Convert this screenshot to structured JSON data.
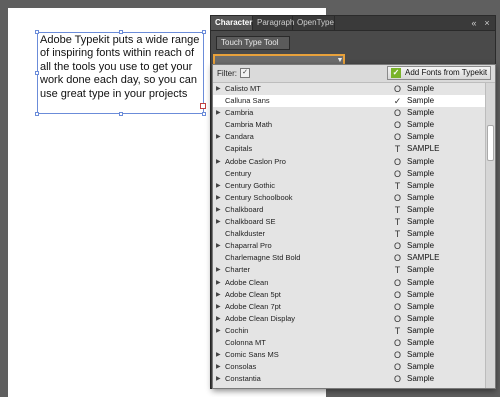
{
  "document": {
    "text_lines": [
      "Adobe Typekit puts a wide range",
      "of inspiring fonts within reach of",
      "all the tools you use to get your",
      "work done each day, so you can",
      "use great type in your projects"
    ]
  },
  "panel": {
    "tabs": [
      "Character",
      "Paragraph",
      "OpenType"
    ],
    "collapse_icon": "«",
    "close_icon": "×",
    "touch_type_label": "Touch Type Tool",
    "font_field_value": "",
    "font_field_arrow": "▼"
  },
  "dropdown": {
    "filter_label": "Filter:",
    "filter_icon_glyph": "✓",
    "add_fonts_label": "Add Fonts from Typekit",
    "typekit_icon_glyph": "✓",
    "fonts": [
      {
        "name": "Calisto MT",
        "expandable": true,
        "type": "O",
        "sample": "Sample",
        "selected": false
      },
      {
        "name": "Calluna Sans",
        "expandable": false,
        "type": "✓",
        "sample": "Sample",
        "selected": true
      },
      {
        "name": "Cambria",
        "expandable": true,
        "type": "O",
        "sample": "Sample",
        "selected": false
      },
      {
        "name": "Cambria Math",
        "expandable": false,
        "type": "O",
        "sample": "Sample",
        "selected": false
      },
      {
        "name": "Candara",
        "expandable": true,
        "type": "O",
        "sample": "Sample",
        "selected": false
      },
      {
        "name": "Capitals",
        "expandable": false,
        "type": "T",
        "sample": "SAMPLE",
        "selected": false
      },
      {
        "name": "Adobe Caslon Pro",
        "expandable": true,
        "type": "O",
        "sample": "Sample",
        "selected": false
      },
      {
        "name": "Century",
        "expandable": false,
        "type": "O",
        "sample": "Sample",
        "selected": false
      },
      {
        "name": "Century Gothic",
        "expandable": true,
        "type": "T",
        "sample": "Sample",
        "selected": false
      },
      {
        "name": "Century Schoolbook",
        "expandable": true,
        "type": "O",
        "sample": "Sample",
        "selected": false
      },
      {
        "name": "Chalkboard",
        "expandable": true,
        "type": "T",
        "sample": "Sample",
        "selected": false
      },
      {
        "name": "Chalkboard SE",
        "expandable": true,
        "type": "T",
        "sample": "Sample",
        "selected": false
      },
      {
        "name": "Chalkduster",
        "expandable": false,
        "type": "T",
        "sample": "Sample",
        "selected": false
      },
      {
        "name": "Chaparral Pro",
        "expandable": true,
        "type": "O",
        "sample": "Sample",
        "selected": false
      },
      {
        "name": "Charlemagne Std Bold",
        "expandable": false,
        "type": "O",
        "sample": "SAMPLE",
        "selected": false
      },
      {
        "name": "Charter",
        "expandable": true,
        "type": "T",
        "sample": "Sample",
        "selected": false
      },
      {
        "name": "Adobe Clean",
        "expandable": true,
        "type": "O",
        "sample": "Sample",
        "selected": false
      },
      {
        "name": "Adobe Clean 5pt",
        "expandable": true,
        "type": "O",
        "sample": "Sample",
        "selected": false
      },
      {
        "name": "Adobe Clean 7pt",
        "expandable": true,
        "type": "O",
        "sample": "Sample",
        "selected": false
      },
      {
        "name": "Adobe Clean Display",
        "expandable": true,
        "type": "O",
        "sample": "Sample",
        "selected": false
      },
      {
        "name": "Cochin",
        "expandable": true,
        "type": "T",
        "sample": "Sample",
        "selected": false
      },
      {
        "name": "Colonna MT",
        "expandable": false,
        "type": "O",
        "sample": "Sample",
        "selected": false
      },
      {
        "name": "Comic Sans MS",
        "expandable": true,
        "type": "O",
        "sample": "Sample",
        "selected": false
      },
      {
        "name": "Consolas",
        "expandable": true,
        "type": "O",
        "sample": "Sample",
        "selected": false
      },
      {
        "name": "Constantia",
        "expandable": true,
        "type": "O",
        "sample": "Sample",
        "selected": false
      }
    ]
  }
}
